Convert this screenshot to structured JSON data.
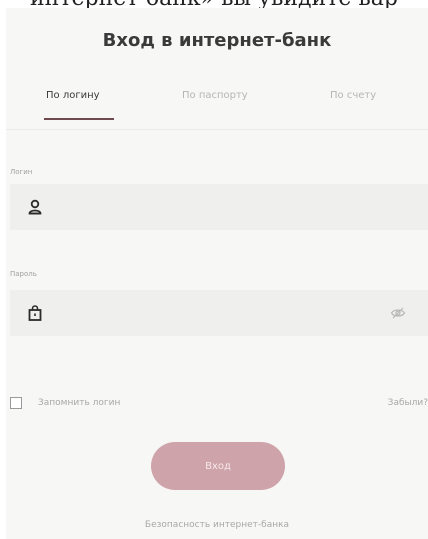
{
  "header_caption": "интернет-банк» вы увидите вар",
  "title": "Вход в интернет-банк",
  "tabs": [
    {
      "label": "По логину",
      "active": true
    },
    {
      "label": "По паспорту",
      "active": false
    },
    {
      "label": "По счету",
      "active": false
    }
  ],
  "login_field": {
    "label": "Логин",
    "value": "",
    "icon": "user-icon"
  },
  "password_field": {
    "label": "Пароль",
    "value": "",
    "icon": "lock-icon",
    "toggle_icon": "eye-slash-icon"
  },
  "remember": {
    "label": "Запомнить логин",
    "checked": false
  },
  "forgot_label": "Забыли?",
  "login_button_label": "Вход",
  "security_link": "Безопасность интернет-банка",
  "colors": {
    "accent": "#6e4a4f",
    "button": "#cfa3aa",
    "panel": "#f7f7f6",
    "field": "#efefee"
  }
}
